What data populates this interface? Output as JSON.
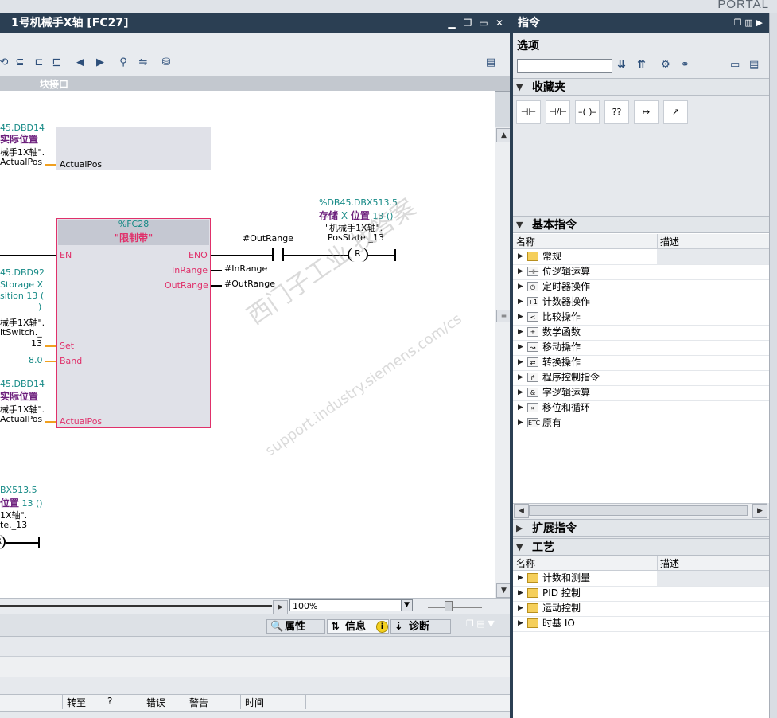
{
  "portal_label": "PORTAL",
  "editor": {
    "title": "1号机械手X轴 [FC27]",
    "interface_label": "块接口",
    "zoom": "100%"
  },
  "network_top": {
    "addr": "45.DBD14",
    "tag": "实际位置",
    "db": "械手1X轴\".",
    "param": "ActualPos",
    "pin": "ActualPos"
  },
  "fc": {
    "addr": "%FC28",
    "name": "\"限制带\"",
    "in_en": "EN",
    "in_set": "Set",
    "in_band": "Band",
    "in_actual": "ActualPos",
    "out_eno": "ENO",
    "out_inrange": "InRange",
    "out_outrange": "OutRange",
    "inrange_var": "#InRange",
    "outrange_var": "#OutRange",
    "set_addr": "45.DBD92",
    "set_l1": "Storage X",
    "set_l2": "sition 13 (",
    "set_l3": ")",
    "set_l4": "械手1X轴\".",
    "set_l5": "itSwitch._",
    "set_l6": "13",
    "band_val": "8.0",
    "act_addr": "45.DBD14",
    "act_tag": "实际位置",
    "act_db": "械手1X轴\".",
    "act_param": "ActualPos"
  },
  "contact": {
    "var": "#OutRange",
    "coil_addr": "%DB45.DBX513.5",
    "coil_tag_a": "存储",
    "coil_tag_b": " X ",
    "coil_tag_c": "位置",
    "coil_tag_d": " 13 ()",
    "coil_db": "\"机械手1X轴\".",
    "coil_param": "PosState._13",
    "coil_letter": "R"
  },
  "network_bottom": {
    "addr": "BX513.5",
    "tag_a": "位置",
    "tag_b": " 13 ()",
    "db": "1X轴\".",
    "param": "te._13",
    "coil_letter": "R"
  },
  "inspector": {
    "tabs": [
      "属性",
      "信息",
      "诊断"
    ],
    "columns": [
      "转至",
      "?",
      "错误",
      "警告",
      "时间"
    ]
  },
  "instructions": {
    "title": "指令",
    "options_label": "选项",
    "favorites_label": "收藏夹",
    "favorites": [
      "⊣⊢",
      "⊣/⊢",
      "–( )–",
      "??",
      "↦",
      "↗"
    ],
    "basic": {
      "label": "基本指令",
      "col_name": "名称",
      "col_desc": "描述",
      "items": [
        {
          "icon": "folder-icon",
          "label": "常规"
        },
        {
          "icon": "bit-logic-icon",
          "label": "位逻辑运算"
        },
        {
          "icon": "timer-icon",
          "label": "定时器操作"
        },
        {
          "icon": "counter-icon",
          "label": "计数器操作"
        },
        {
          "icon": "compare-icon",
          "label": "比较操作"
        },
        {
          "icon": "math-icon",
          "label": "数学函数"
        },
        {
          "icon": "move-icon",
          "label": "移动操作"
        },
        {
          "icon": "convert-icon",
          "label": "转换操作"
        },
        {
          "icon": "program-control-icon",
          "label": "程序控制指令"
        },
        {
          "icon": "word-logic-icon",
          "label": "字逻辑运算"
        },
        {
          "icon": "shift-icon",
          "label": "移位和循环"
        },
        {
          "icon": "etc-icon",
          "label": "原有"
        }
      ]
    },
    "extended_label": "扩展指令",
    "technology": {
      "label": "工艺",
      "col_name": "名称",
      "col_desc": "描述",
      "items": [
        {
          "icon": "folder-icon",
          "label": "计数和测量"
        },
        {
          "icon": "folder-icon",
          "label": "PID 控制"
        },
        {
          "icon": "folder-icon",
          "label": "运动控制"
        },
        {
          "icon": "folder-icon",
          "label": "时基 IO"
        }
      ]
    }
  },
  "watermark": {
    "line1": "西门子工业  找答案",
    "line2": "support.industry.siemens.com/cs"
  }
}
